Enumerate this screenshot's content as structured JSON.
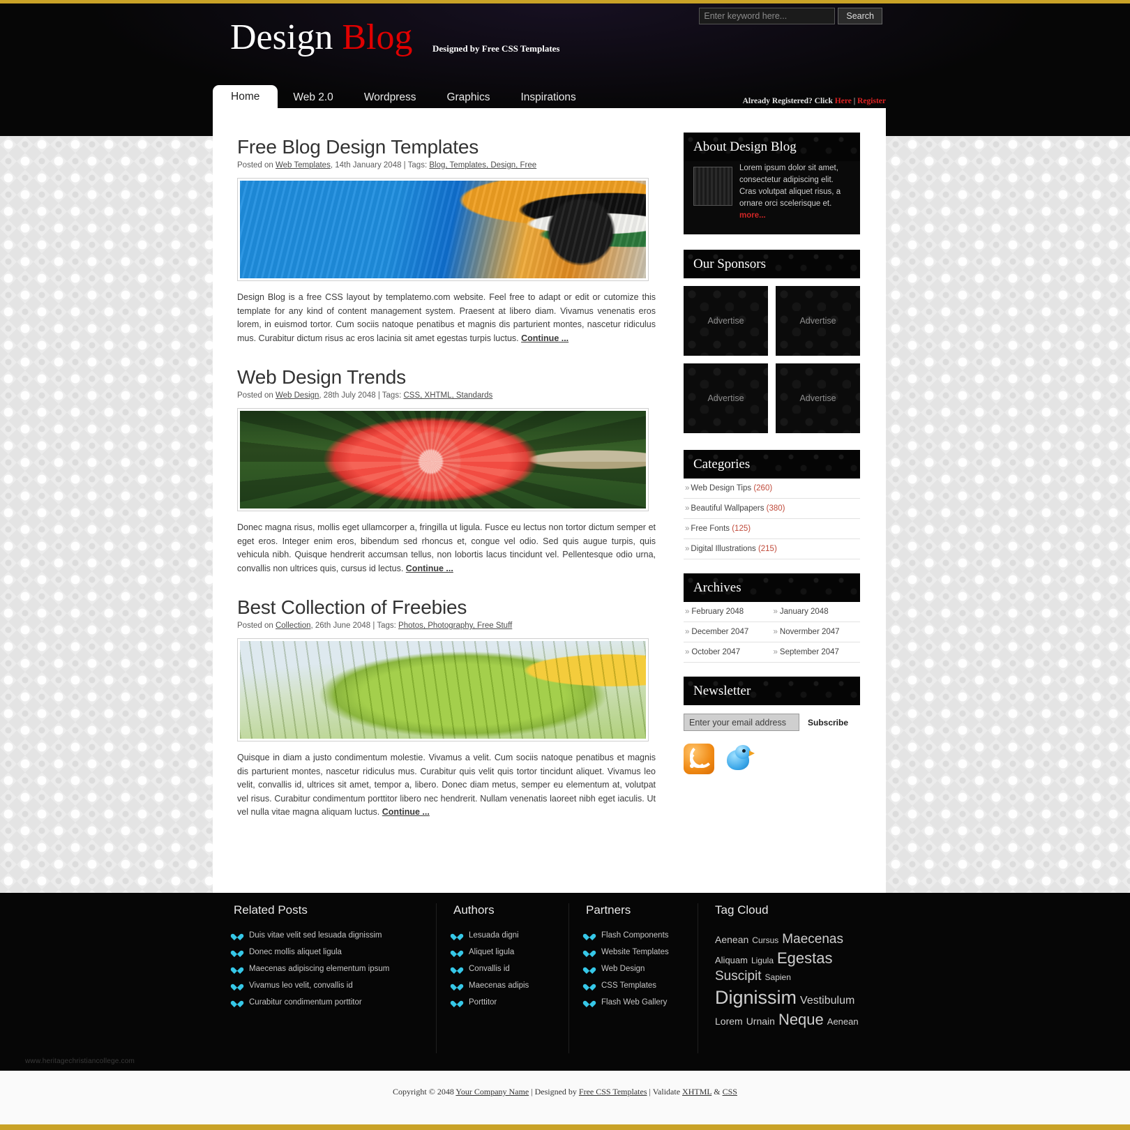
{
  "site": {
    "logo_primary": "Design",
    "logo_accent": "Blog",
    "tagline": "Designed by Free CSS Templates"
  },
  "search": {
    "placeholder": "Enter keyword here...",
    "button_label": "Search"
  },
  "nav": {
    "items": [
      {
        "label": "Home",
        "active": true
      },
      {
        "label": "Web 2.0",
        "active": false
      },
      {
        "label": "Wordpress",
        "active": false
      },
      {
        "label": "Graphics",
        "active": false
      },
      {
        "label": "Inspirations",
        "active": false
      }
    ],
    "register_prefix": "Already Registered? Click ",
    "register_here": "Here",
    "register_sep": " | ",
    "register_link": "Register"
  },
  "posts": [
    {
      "title": "Free Blog Design Templates",
      "meta_prefix": "Posted on ",
      "category": "Web Templates",
      "date": ", 14th January 2048 | Tags: ",
      "tags": "Blog, Templates, Design, Free",
      "image": "parrot-photo",
      "body": "Design Blog is a free CSS layout by templatemo.com website. Feel free to adapt or edit or cutomize this template for any kind of content management system. Praesent at libero diam. Vivamus venenatis eros lorem, in euismod tortor. Cum sociis natoque penatibus et magnis dis parturient montes, nascetur ridiculus mus. Curabitur dictum risus ac eros lacinia sit amet egestas turpis luctus. ",
      "continue": "Continue ..."
    },
    {
      "title": "Web Design Trends",
      "meta_prefix": "Posted on ",
      "category": "Web Design",
      "date": ", 28th July 2048 | Tags: ",
      "tags": "CSS, XHTML, Standards",
      "image": "flower-photo",
      "body": "Donec magna risus, mollis eget ullamcorper a, fringilla ut ligula. Fusce eu lectus non tortor dictum semper et eget eros. Integer enim eros, bibendum sed rhoncus et, congue vel odio. Sed quis augue turpis, quis vehicula nibh. Quisque hendrerit accumsan tellus, non lobortis lacus tincidunt vel. Pellentesque odio urna, convallis non ultrices quis, cursus id lectus. ",
      "continue": "Continue ..."
    },
    {
      "title": "Best Collection of Freebies",
      "meta_prefix": "Posted on ",
      "category": "Collection",
      "date": ", 26th June 2048 | Tags: ",
      "tags": "Photos, Photography, Free Stuff",
      "image": "banana-photo",
      "body": "Quisque in diam a justo condimentum molestie. Vivamus a velit. Cum sociis natoque penatibus et magnis dis parturient montes, nascetur ridiculus mus. Curabitur quis velit quis tortor tincidunt aliquet. Vivamus leo velit, convallis id, ultrices sit amet, tempor a, libero. Donec diam metus, semper eu elementum at, volutpat vel risus. Curabitur condimentum porttitor libero nec hendrerit. Nullam venenatis laoreet nibh eget iaculis. Ut vel nulla vitae magna aliquam luctus. ",
      "continue": "Continue ..."
    }
  ],
  "sidebar": {
    "about": {
      "title": "About Design Blog",
      "text": "Lorem ipsum dolor sit amet, consectetur adipiscing elit. Cras volutpat aliquet risus, a ornare orci scelerisque et. ",
      "more": "more..."
    },
    "sponsors": {
      "title": "Our Sponsors",
      "ads": [
        "Advertise",
        "Advertise",
        "Advertise",
        "Advertise"
      ]
    },
    "categories": {
      "title": "Categories",
      "items": [
        {
          "label": "Web Design Tips",
          "count": "(260)"
        },
        {
          "label": "Beautiful Wallpapers",
          "count": "(380)"
        },
        {
          "label": "Free Fonts",
          "count": "(125)"
        },
        {
          "label": "Digital Illustrations",
          "count": "(215)"
        }
      ]
    },
    "archives": {
      "title": "Archives",
      "items": [
        "February 2048",
        "January 2048",
        "December 2047",
        "Novermber 2047",
        "October 2047",
        "September 2047"
      ]
    },
    "newsletter": {
      "title": "Newsletter",
      "placeholder": "Enter your email address",
      "subscribe_label": "Subscribe",
      "icons": [
        "rss-icon",
        "twitter-bird-icon"
      ]
    }
  },
  "footer": {
    "columns": [
      {
        "title": "Related Posts",
        "items": [
          "Duis vitae velit sed lesuada dignissim",
          "Donec mollis aliquet ligula",
          "Maecenas adipiscing elementum ipsum",
          "Vivamus leo velit, convallis id",
          "Curabitur condimentum porttitor"
        ]
      },
      {
        "title": "Authors",
        "items": [
          "Lesuada digni",
          "Aliquet ligula",
          "Convallis id",
          "Maecenas adipis",
          "Porttitor"
        ]
      },
      {
        "title": "Partners",
        "items": [
          "Flash Components",
          "Website Templates",
          "Web Design",
          "CSS Templates",
          "Flash Web Gallery"
        ]
      }
    ],
    "tagcloud": {
      "title": "Tag Cloud",
      "tags": [
        {
          "label": "Aenean",
          "size": 14
        },
        {
          "label": "Cursus",
          "size": 12
        },
        {
          "label": "Maecenas",
          "size": 19
        },
        {
          "label": "Aliquam",
          "size": 13
        },
        {
          "label": "Ligula",
          "size": 12
        },
        {
          "label": "Egestas",
          "size": 22
        },
        {
          "label": "Suscipit",
          "size": 19
        },
        {
          "label": "Sapien",
          "size": 12
        },
        {
          "label": "Dignissim",
          "size": 27
        },
        {
          "label": "Vestibulum",
          "size": 16
        },
        {
          "label": "Lorem",
          "size": 14
        },
        {
          "label": "Urnain",
          "size": 14
        },
        {
          "label": "Neque",
          "size": 22
        },
        {
          "label": "Aenean",
          "size": 13
        }
      ]
    }
  },
  "watermark": "www.heritagechristiancollege.com",
  "copyright": {
    "prefix": "Copyright © 2048 ",
    "company": "Your Company Name",
    "middle": " | Designed by ",
    "designer": "Free CSS Templates",
    "validate": " | Validate ",
    "xhtml": "XHTML",
    "amp": " & ",
    "css": "CSS"
  },
  "colors": {
    "accent_red": "#e00000",
    "gold_rule": "#c9a227",
    "link_red": "#c02020",
    "bullet_cyan": "#36c8e8"
  }
}
